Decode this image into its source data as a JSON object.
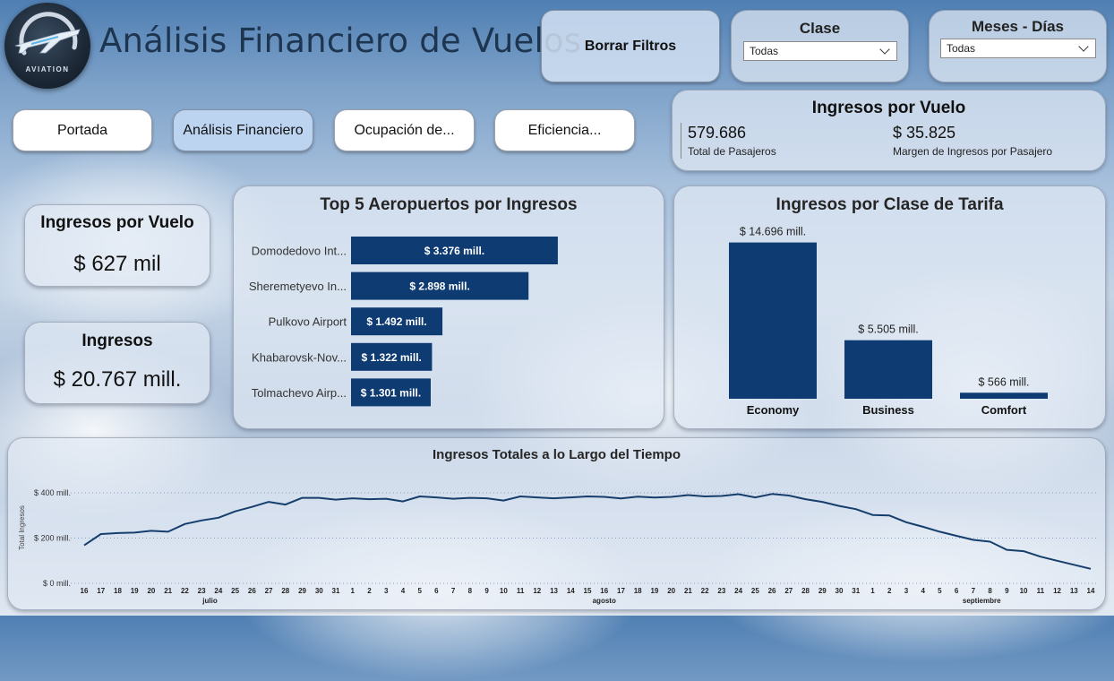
{
  "header": {
    "logo_text": "AVIATION",
    "title": "Análisis Financiero de Vuelos",
    "clear_filters_label": "Borrar Filtros"
  },
  "filters": {
    "clase": {
      "label": "Clase",
      "value": "Todas"
    },
    "meses": {
      "label": "Meses - Días",
      "value": "Todas"
    }
  },
  "nav": {
    "items": [
      {
        "label": "Portada",
        "active": false
      },
      {
        "label": "Análisis Financiero",
        "active": true
      },
      {
        "label": "Ocupación de...",
        "active": false
      },
      {
        "label": "Eficiencia...",
        "active": false
      }
    ]
  },
  "summary": {
    "title": "Ingresos por Vuelo",
    "passengers_value": "579.686",
    "passengers_label": "Total de Pasajeros",
    "margin_value": "$ 35.825",
    "margin_label": "Margen de Ingresos por Pasajero"
  },
  "kpis": {
    "per_flight": {
      "title": "Ingresos por Vuelo",
      "value": "$ 627 mil"
    },
    "total": {
      "title": "Ingresos",
      "value": "$ 20.767 mill."
    }
  },
  "colors": {
    "bar": "#0f3b73",
    "line": "#163e6d",
    "accent": "#bcd4f0"
  },
  "chart_data": [
    {
      "type": "bar",
      "orientation": "horizontal",
      "title": "Top 5 Aeropuertos por Ingresos",
      "categories": [
        "Domodedovo Int...",
        "Sheremetyevo In...",
        "Pulkovo Airport",
        "Khabarovsk-Nov...",
        "Tolmachevo Airp..."
      ],
      "values": [
        3376,
        2898,
        1492,
        1322,
        1301
      ],
      "data_labels": [
        "$ 3.376 mill.",
        "$ 2.898 mill.",
        "$ 1.492 mill.",
        "$ 1.322 mill.",
        "$ 1.301 mill."
      ],
      "xlim": [
        0,
        5000
      ]
    },
    {
      "type": "bar",
      "title": "Ingresos por Clase de Tarifa",
      "categories": [
        "Economy",
        "Business",
        "Comfort"
      ],
      "values": [
        14696,
        5505,
        566
      ],
      "data_labels": [
        "$ 14.696 mill.",
        "$ 5.505 mill.",
        "$ 566 mill."
      ],
      "ylim": [
        0,
        15000
      ]
    },
    {
      "type": "line",
      "title": "Ingresos Totales a lo Largo del Tiempo",
      "ylabel": "Total Ingresos",
      "yticks": [
        "$ 400 mill.",
        "$ 200 mill.",
        "$ 0 mill."
      ],
      "ytick_values": [
        400,
        200,
        0
      ],
      "ylim": [
        0,
        430
      ],
      "grid": true,
      "x": [
        "16",
        "17",
        "18",
        "19",
        "20",
        "21",
        "22",
        "23",
        "24",
        "25",
        "26",
        "27",
        "28",
        "29",
        "30",
        "31",
        "1",
        "2",
        "3",
        "4",
        "5",
        "6",
        "7",
        "8",
        "9",
        "10",
        "11",
        "12",
        "13",
        "14",
        "15",
        "16",
        "17",
        "18",
        "19",
        "20",
        "21",
        "22",
        "23",
        "24",
        "25",
        "26",
        "27",
        "28",
        "29",
        "30",
        "31",
        "1",
        "2",
        "3",
        "4",
        "5",
        "6",
        "7",
        "8",
        "9",
        "10",
        "11",
        "12",
        "13",
        "14"
      ],
      "month_labels": [
        {
          "label": "julio",
          "index": 7.5
        },
        {
          "label": "agosto",
          "index": 31
        },
        {
          "label": "septiembre",
          "index": 53.5
        }
      ],
      "values": [
        168,
        218,
        222,
        224,
        232,
        228,
        262,
        278,
        290,
        318,
        338,
        360,
        348,
        378,
        378,
        370,
        376,
        372,
        374,
        362,
        384,
        380,
        374,
        378,
        376,
        366,
        384,
        380,
        376,
        380,
        384,
        382,
        375,
        383,
        379,
        382,
        390,
        384,
        386,
        394,
        380,
        395,
        388,
        372,
        360,
        342,
        328,
        302,
        300,
        270,
        250,
        228,
        210,
        192,
        184,
        148,
        142,
        118,
        100,
        82,
        64
      ]
    }
  ]
}
